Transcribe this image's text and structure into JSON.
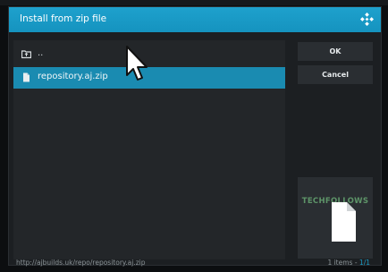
{
  "dialog": {
    "title": "Install from zip file"
  },
  "file_list": {
    "items": [
      {
        "label": "..",
        "icon": "folder-up-icon",
        "selected": false
      },
      {
        "label": "repository.aj.zip",
        "icon": "file-icon",
        "selected": true
      }
    ]
  },
  "buttons": {
    "ok_label": "OK",
    "cancel_label": "Cancel"
  },
  "thumbnail": {
    "watermark": "TECHFOLLOWS",
    "icon": "document-icon"
  },
  "footer": {
    "path": "http://ajbuilds.uk/repo/repository.aj.zip",
    "items_text": "1 items - ",
    "page_text": "1/1"
  },
  "colors": {
    "accent": "#1593bf",
    "selected_row": "#1a8bb1",
    "panel": "#232629",
    "button": "#2a2e32"
  }
}
